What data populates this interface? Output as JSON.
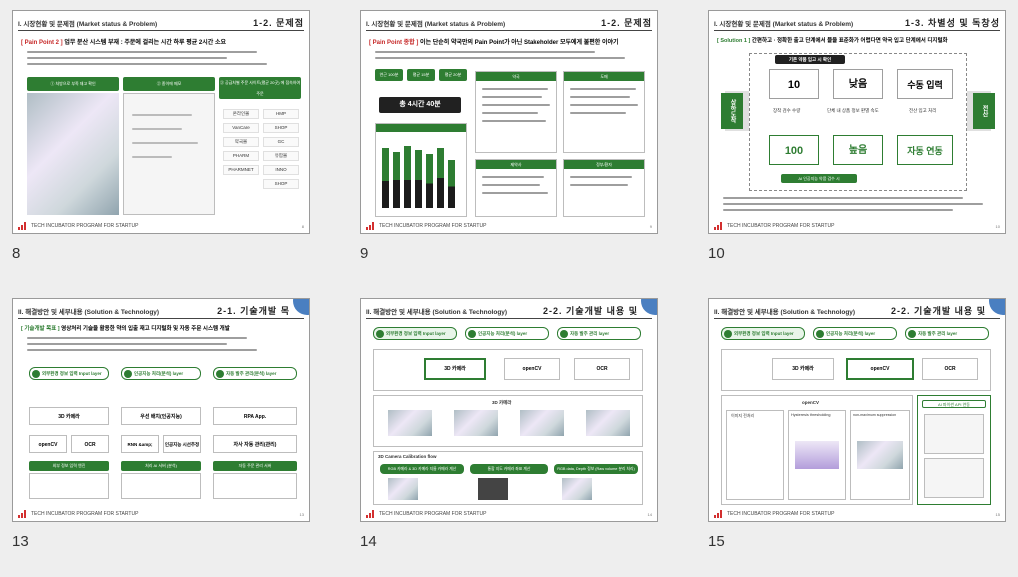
{
  "footer_text": "TECH INCUBATOR PROGRAM FOR STARTUP",
  "accent_color": "#2e7d32",
  "brand_color": "#d32f2f",
  "slides": [
    {
      "number": "8",
      "page": "8",
      "section": "I. 시장현황 및 문제점 (Market status & Problem)",
      "chapter": "1-2. 문제점",
      "point_tag": "[ Pain Point 2 ]",
      "point_text": "업무 분산 시스템 부재 : 주문에 걸리는 시간 하루 평균 2시간 소요",
      "header_a": "① 처방으로 부족 재고 확인",
      "header_b": "② 종이에 메모",
      "header_c": "③ 공급처별 주문 사이트(평균 20곳) 에 접속하여 주문",
      "sites": [
        "온라인몰",
        "HMP",
        "VanCare",
        "SHOP",
        "약국몰",
        "GC",
        "PHARM",
        "유팜몰",
        "PHARMNET",
        "INNO",
        "SHOP"
      ]
    },
    {
      "number": "9",
      "page": "9",
      "section": "I. 시장현황 및 문제점 (Market status & Problem)",
      "chapter": "1-2. 문제점",
      "point_tag": "[ Pain Point 종합 ]",
      "point_text": "이는 단순히 약국만의 Pain Point가 아닌 Stakeholder 모두에게 불편한 이야기",
      "stat1": "연근 100분",
      "stat2": "평균 15분",
      "stat3": "평균 20분",
      "total": "총 4시간 40분",
      "panel_a": "약국",
      "panel_b": "도매",
      "panel_c": "제약사",
      "panel_d": "정부/환자"
    },
    {
      "number": "10",
      "page": "10",
      "section": "I. 시장현황 및 문제점 (Market status & Problem)",
      "chapter": "1-3. 차별성 및 독창성",
      "point_tag": "[ Solution 1 ]",
      "point_text": "간편하고 · 정확한 출고 단계에서 물을 표준화가 어렵다면 약국 입고 단계에서 디지털화",
      "top_label": "기존 약품 입고 시 확인",
      "left_side": "상하도착",
      "right_side": "전산",
      "row1": [
        "10",
        "낮음",
        "수동 입력"
      ],
      "row2": [
        "100",
        "높음",
        "자동 연동"
      ],
      "mid_labels": [
        "장착 검수 수량",
        "단체 내 상품 정보 판별 속도",
        "전산 입고 처리"
      ],
      "bottom_label": "AI 인공지능 약품 검수 시"
    },
    {
      "number": "13",
      "page": "13",
      "section": "II. 해결방안 및 세부내용 (Solution & Technology)",
      "chapter": "2-1. 기술개발 목",
      "point_tag": "[ 기술개발 목표 ]",
      "point_text": "영상처리 기술을 활용한 약의 입출 재고 디지털화 및 자동 주문 시스템 개발",
      "layer_a": "외부환경 정보 입력 Input layer",
      "layer_b": "인공지능 처리(분석) layer",
      "layer_c": "자동 발주 관리(분석) layer",
      "tech_a1": "3D 카메라",
      "tech_b1": "우선 배치(인공지능)",
      "tech_c1": "RPA App.",
      "tech_a2": "openCV",
      "tech_a3": "OCR",
      "tech_b2": "RNN &amp; LSTM",
      "tech_b3": "인공지능 시선추정",
      "tech_c2": "자사 자동 관리(관리)",
      "goal_a": "외부 정보 입력 엔진",
      "goal_b": "처리 AI 서버 (분석)",
      "goal_c": "자동 주문 관리 서버"
    },
    {
      "number": "14",
      "page": "14",
      "section": "II. 해결방안 및 세부내용 (Solution & Technology)",
      "chapter": "2-2. 기술개발 내용 및",
      "tab_a": "외부환경 정보 입력 Input layer",
      "tab_b": "인공지능 처리(분석) layer",
      "tab_c": "자동 발주 관리 layer",
      "row_tech": [
        "3D 카메라",
        "openCV",
        "OCR"
      ],
      "section_title": "3D 카메라",
      "calib_title": "3D Camera Calibration flow",
      "steps": [
        "RGB 카메라 & 3D 카메라 지름 카메라 계산",
        "통합 지도 카메라 좌표 계산",
        "RGB data, Depth 정보 (Raw volume 분리 처리)"
      ]
    },
    {
      "number": "15",
      "page": "15",
      "section": "II. 해결방안 및 세부내용 (Solution & Technology)",
      "chapter": "2-2. 기술개발 내용 및",
      "tab_a": "외부환경 정보 입력 Input layer",
      "tab_b": "인공지능 처리(분석) layer",
      "tab_c": "자동 발주 관리 layer",
      "row_tech": [
        "3D 카메라",
        "openCV",
        "OCR"
      ],
      "section_title": "openCV",
      "sub_titles": [
        "이미지 전처리",
        "Hysteresis thresholding",
        "non-maximum suppression"
      ],
      "api_title": "AI 파이썬 API 연동"
    }
  ]
}
